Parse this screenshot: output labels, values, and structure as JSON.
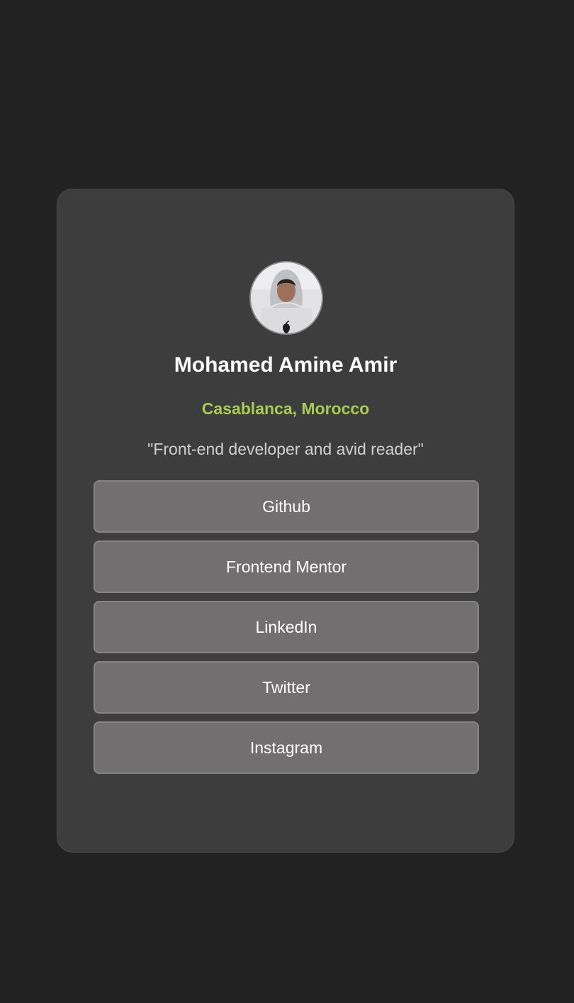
{
  "profile": {
    "name": "Mohamed Amine Amir",
    "location": "Casablanca, Morocco",
    "bio": "\"Front-end developer and avid reader\""
  },
  "links": [
    {
      "label": "Github"
    },
    {
      "label": "Frontend Mentor"
    },
    {
      "label": "LinkedIn"
    },
    {
      "label": "Twitter"
    },
    {
      "label": "Instagram"
    }
  ],
  "colors": {
    "page_background": "#222222",
    "card_background": "#3d3d3d",
    "accent": "#aacb4e",
    "button_background": "#726f70"
  }
}
